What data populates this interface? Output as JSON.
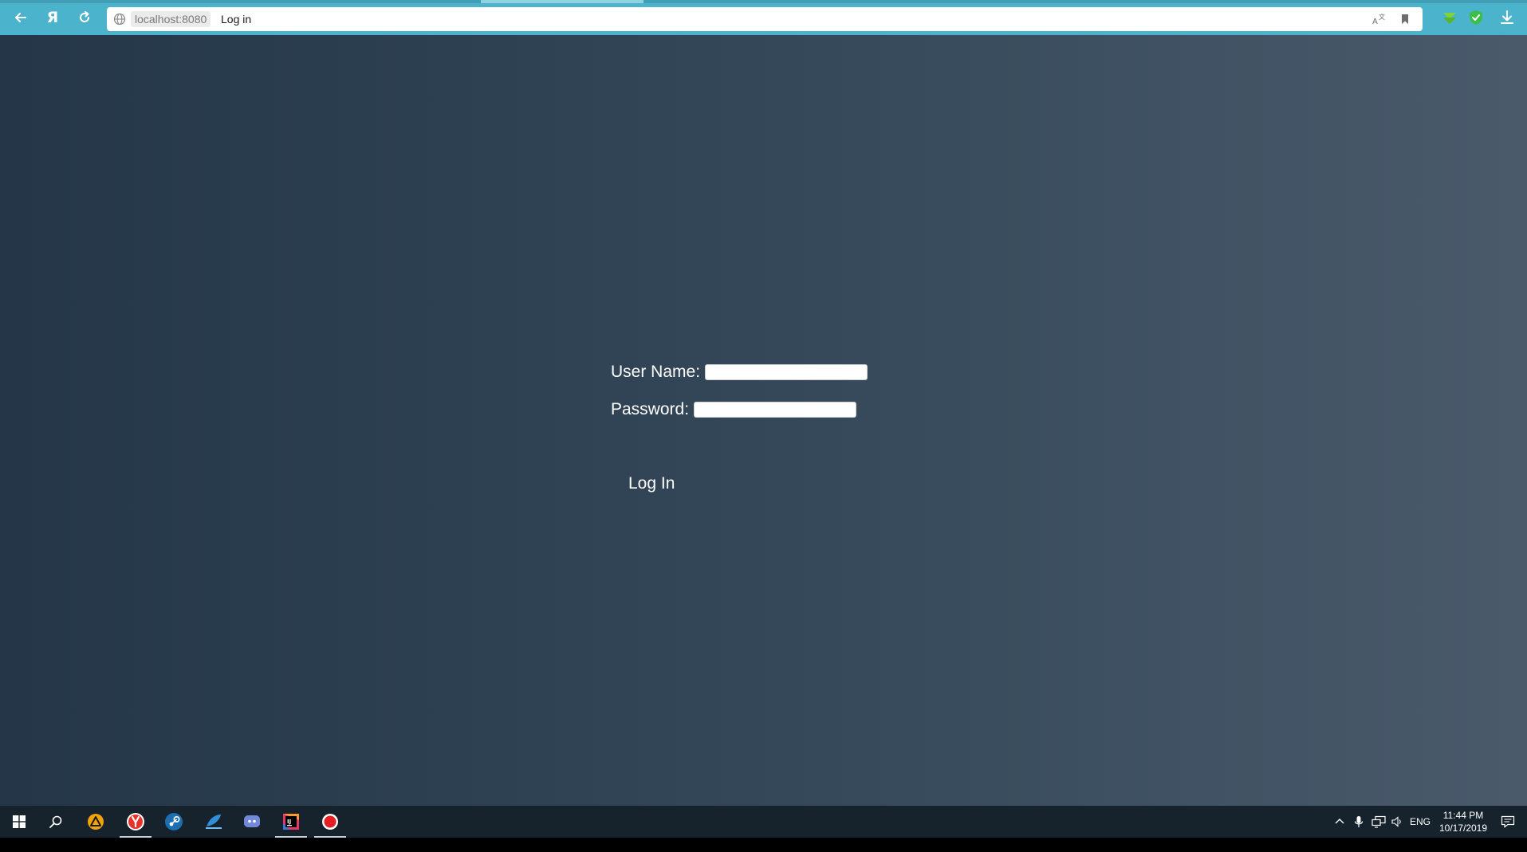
{
  "browser": {
    "url_domain": "localhost:8080",
    "page_title": "Log in",
    "nav_icons": [
      "back-arrow-icon",
      "yandex-logo-icon",
      "reload-icon"
    ],
    "url_icons": [
      "globe-icon",
      "translate-icon",
      "bookmark-icon"
    ],
    "extension_icons": [
      "download-arrow-extension-icon",
      "protect-shield-icon",
      "downloads-icon"
    ],
    "colors": {
      "chrome": "#4cb3cc",
      "url_bar": "#ffffff"
    }
  },
  "login": {
    "username_label": "User Name:",
    "username_value": "",
    "password_label": "Password:",
    "password_value": "",
    "submit_label": "Log In"
  },
  "taskbar": {
    "apps": [
      "windows-start-icon",
      "search-icon",
      "app-triangle-icon",
      "yandex-browser-icon",
      "steam-icon",
      "feather-app-icon",
      "discord-icon",
      "intellij-idea-icon",
      "record-icon"
    ],
    "tray": {
      "language": "ENG",
      "time": "11:44 PM",
      "date": "10/17/2019"
    }
  }
}
